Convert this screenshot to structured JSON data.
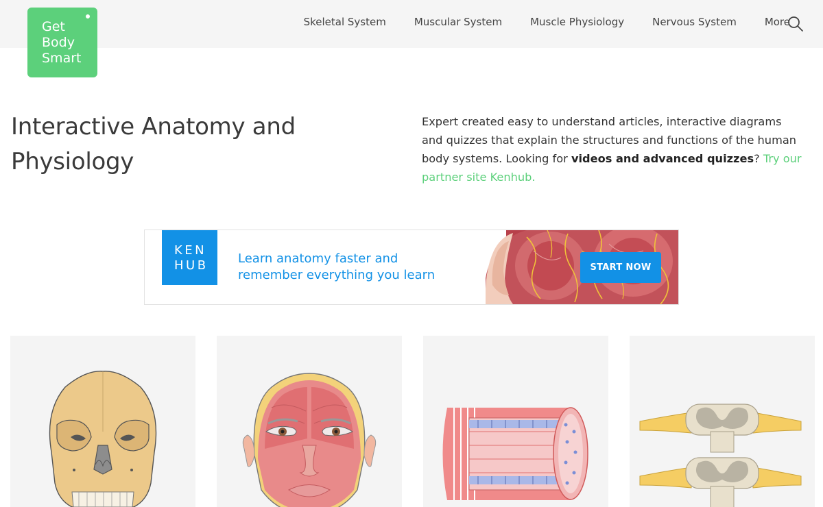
{
  "logo": {
    "line1": "Get",
    "line2": "Body",
    "line3": "Smart"
  },
  "nav": {
    "items": [
      "Skeletal System",
      "Muscular System",
      "Muscle Physiology",
      "Nervous System",
      "More"
    ],
    "search_icon": "search-icon"
  },
  "hero": {
    "title": "Interactive Anatomy and Physiology",
    "desc_part1": "Expert created easy to understand articles, interactive diagrams and quizzes that explain the structures and functions of the human body systems. Looking for ",
    "desc_bold": "videos and advanced quizzes",
    "desc_part2": "? ",
    "desc_link": "Try our partner site Kenhub."
  },
  "banner": {
    "logo_line1": "KEN",
    "logo_line2": "HUB",
    "line1": "Learn anatomy faster and",
    "line2": "remember everything you learn",
    "button": "START NOW"
  },
  "cards": [
    {
      "icon": "skull-icon"
    },
    {
      "icon": "face-muscles-icon"
    },
    {
      "icon": "muscle-fiber-icon"
    },
    {
      "icon": "spinal-cord-icon"
    }
  ],
  "colors": {
    "brand_green": "#5cd07b",
    "kenhub_blue": "#1291e6",
    "header_bg": "#f5f5f5",
    "card_bg": "#f4f4f4"
  }
}
